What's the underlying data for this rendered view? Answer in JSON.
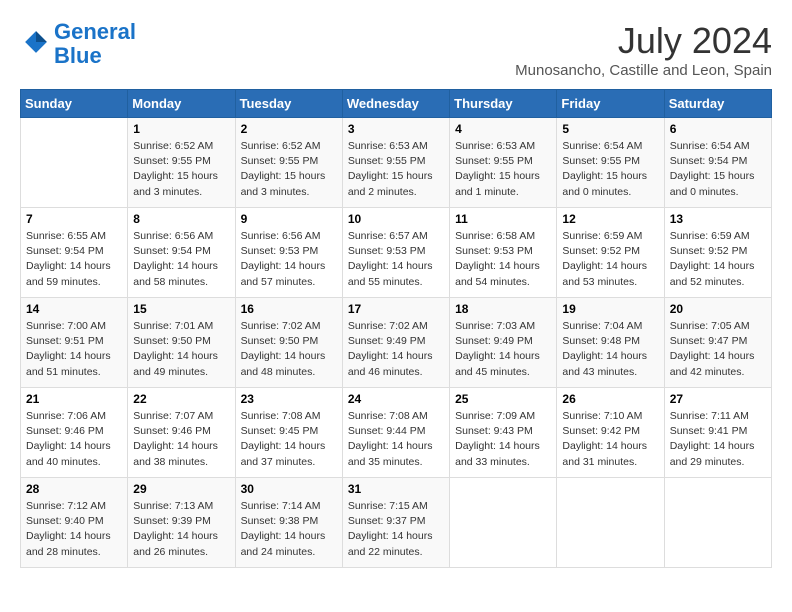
{
  "logo": {
    "line1": "General",
    "line2": "Blue"
  },
  "title": "July 2024",
  "location": "Munosancho, Castille and Leon, Spain",
  "days_header": [
    "Sunday",
    "Monday",
    "Tuesday",
    "Wednesday",
    "Thursday",
    "Friday",
    "Saturday"
  ],
  "weeks": [
    [
      {
        "day": "",
        "info": ""
      },
      {
        "day": "1",
        "info": "Sunrise: 6:52 AM\nSunset: 9:55 PM\nDaylight: 15 hours\nand 3 minutes."
      },
      {
        "day": "2",
        "info": "Sunrise: 6:52 AM\nSunset: 9:55 PM\nDaylight: 15 hours\nand 3 minutes."
      },
      {
        "day": "3",
        "info": "Sunrise: 6:53 AM\nSunset: 9:55 PM\nDaylight: 15 hours\nand 2 minutes."
      },
      {
        "day": "4",
        "info": "Sunrise: 6:53 AM\nSunset: 9:55 PM\nDaylight: 15 hours\nand 1 minute."
      },
      {
        "day": "5",
        "info": "Sunrise: 6:54 AM\nSunset: 9:55 PM\nDaylight: 15 hours\nand 0 minutes."
      },
      {
        "day": "6",
        "info": "Sunrise: 6:54 AM\nSunset: 9:54 PM\nDaylight: 15 hours\nand 0 minutes."
      }
    ],
    [
      {
        "day": "7",
        "info": "Sunrise: 6:55 AM\nSunset: 9:54 PM\nDaylight: 14 hours\nand 59 minutes."
      },
      {
        "day": "8",
        "info": "Sunrise: 6:56 AM\nSunset: 9:54 PM\nDaylight: 14 hours\nand 58 minutes."
      },
      {
        "day": "9",
        "info": "Sunrise: 6:56 AM\nSunset: 9:53 PM\nDaylight: 14 hours\nand 57 minutes."
      },
      {
        "day": "10",
        "info": "Sunrise: 6:57 AM\nSunset: 9:53 PM\nDaylight: 14 hours\nand 55 minutes."
      },
      {
        "day": "11",
        "info": "Sunrise: 6:58 AM\nSunset: 9:53 PM\nDaylight: 14 hours\nand 54 minutes."
      },
      {
        "day": "12",
        "info": "Sunrise: 6:59 AM\nSunset: 9:52 PM\nDaylight: 14 hours\nand 53 minutes."
      },
      {
        "day": "13",
        "info": "Sunrise: 6:59 AM\nSunset: 9:52 PM\nDaylight: 14 hours\nand 52 minutes."
      }
    ],
    [
      {
        "day": "14",
        "info": "Sunrise: 7:00 AM\nSunset: 9:51 PM\nDaylight: 14 hours\nand 51 minutes."
      },
      {
        "day": "15",
        "info": "Sunrise: 7:01 AM\nSunset: 9:50 PM\nDaylight: 14 hours\nand 49 minutes."
      },
      {
        "day": "16",
        "info": "Sunrise: 7:02 AM\nSunset: 9:50 PM\nDaylight: 14 hours\nand 48 minutes."
      },
      {
        "day": "17",
        "info": "Sunrise: 7:02 AM\nSunset: 9:49 PM\nDaylight: 14 hours\nand 46 minutes."
      },
      {
        "day": "18",
        "info": "Sunrise: 7:03 AM\nSunset: 9:49 PM\nDaylight: 14 hours\nand 45 minutes."
      },
      {
        "day": "19",
        "info": "Sunrise: 7:04 AM\nSunset: 9:48 PM\nDaylight: 14 hours\nand 43 minutes."
      },
      {
        "day": "20",
        "info": "Sunrise: 7:05 AM\nSunset: 9:47 PM\nDaylight: 14 hours\nand 42 minutes."
      }
    ],
    [
      {
        "day": "21",
        "info": "Sunrise: 7:06 AM\nSunset: 9:46 PM\nDaylight: 14 hours\nand 40 minutes."
      },
      {
        "day": "22",
        "info": "Sunrise: 7:07 AM\nSunset: 9:46 PM\nDaylight: 14 hours\nand 38 minutes."
      },
      {
        "day": "23",
        "info": "Sunrise: 7:08 AM\nSunset: 9:45 PM\nDaylight: 14 hours\nand 37 minutes."
      },
      {
        "day": "24",
        "info": "Sunrise: 7:08 AM\nSunset: 9:44 PM\nDaylight: 14 hours\nand 35 minutes."
      },
      {
        "day": "25",
        "info": "Sunrise: 7:09 AM\nSunset: 9:43 PM\nDaylight: 14 hours\nand 33 minutes."
      },
      {
        "day": "26",
        "info": "Sunrise: 7:10 AM\nSunset: 9:42 PM\nDaylight: 14 hours\nand 31 minutes."
      },
      {
        "day": "27",
        "info": "Sunrise: 7:11 AM\nSunset: 9:41 PM\nDaylight: 14 hours\nand 29 minutes."
      }
    ],
    [
      {
        "day": "28",
        "info": "Sunrise: 7:12 AM\nSunset: 9:40 PM\nDaylight: 14 hours\nand 28 minutes."
      },
      {
        "day": "29",
        "info": "Sunrise: 7:13 AM\nSunset: 9:39 PM\nDaylight: 14 hours\nand 26 minutes."
      },
      {
        "day": "30",
        "info": "Sunrise: 7:14 AM\nSunset: 9:38 PM\nDaylight: 14 hours\nand 24 minutes."
      },
      {
        "day": "31",
        "info": "Sunrise: 7:15 AM\nSunset: 9:37 PM\nDaylight: 14 hours\nand 22 minutes."
      },
      {
        "day": "",
        "info": ""
      },
      {
        "day": "",
        "info": ""
      },
      {
        "day": "",
        "info": ""
      }
    ]
  ]
}
